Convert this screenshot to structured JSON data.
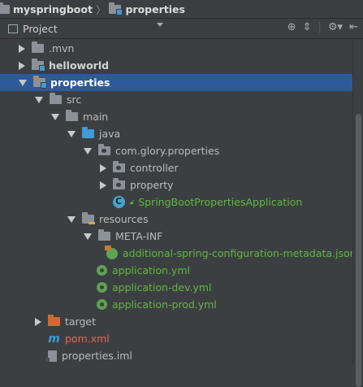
{
  "breadcrumb": {
    "root": "myspringboot",
    "current": "properties"
  },
  "toolbar": {
    "view_label": "Project"
  },
  "tree": [
    {
      "label": "mvn_hidden",
      "text": ".mvn",
      "depth": 1,
      "arrow": "right",
      "icon": "folder",
      "style": ""
    },
    {
      "label": "helloworld",
      "text": "helloworld",
      "depth": 1,
      "arrow": "right",
      "icon": "folder-module",
      "style": "bold"
    },
    {
      "label": "properties",
      "text": "properties",
      "depth": 1,
      "arrow": "down",
      "icon": "folder-module",
      "style": "selected"
    },
    {
      "label": "src",
      "text": "src",
      "depth": 2,
      "arrow": "down",
      "icon": "folder",
      "style": ""
    },
    {
      "label": "main",
      "text": "main",
      "depth": 3,
      "arrow": "down",
      "icon": "folder",
      "style": ""
    },
    {
      "label": "java",
      "text": "java",
      "depth": 4,
      "arrow": "down",
      "icon": "folder-source",
      "style": ""
    },
    {
      "label": "package",
      "text": "com.glory.properties",
      "depth": 5,
      "arrow": "down",
      "icon": "package",
      "style": ""
    },
    {
      "label": "controller",
      "text": "controller",
      "depth": 6,
      "arrow": "right",
      "icon": "package",
      "style": ""
    },
    {
      "label": "property",
      "text": "property",
      "depth": 6,
      "arrow": "right",
      "icon": "package",
      "style": ""
    },
    {
      "label": "app_class",
      "text": "SpringBootPropertiesApplication",
      "depth": 6,
      "arrow": "none",
      "icon": "spring-class",
      "style": "green"
    },
    {
      "label": "resources",
      "text": "resources",
      "depth": 4,
      "arrow": "down",
      "icon": "folder-resources",
      "style": ""
    },
    {
      "label": "meta_inf",
      "text": "META-INF",
      "depth": 5,
      "arrow": "down",
      "icon": "folder",
      "style": ""
    },
    {
      "label": "metadata_json",
      "text": "additional-spring-configuration-metadata.json",
      "depth": 6,
      "arrow": "none",
      "icon": "spring-json",
      "style": "green"
    },
    {
      "label": "app_yml",
      "text": "application.yml",
      "depth": 5,
      "arrow": "none",
      "icon": "spring-config",
      "style": "green"
    },
    {
      "label": "app_dev_yml",
      "text": "application-dev.yml",
      "depth": 5,
      "arrow": "none",
      "icon": "spring-config",
      "style": "green"
    },
    {
      "label": "app_prod_yml",
      "text": "application-prod.yml",
      "depth": 5,
      "arrow": "none",
      "icon": "spring-config",
      "style": "green"
    },
    {
      "label": "target",
      "text": "target",
      "depth": 2,
      "arrow": "right",
      "icon": "folder-excluded",
      "style": ""
    },
    {
      "label": "pom",
      "text": "pom.xml",
      "depth": 2,
      "arrow": "none",
      "icon": "maven",
      "style": "red"
    },
    {
      "label": "iml",
      "text": "properties.iml",
      "depth": 2,
      "arrow": "none",
      "icon": "iml-file",
      "style": ""
    }
  ]
}
